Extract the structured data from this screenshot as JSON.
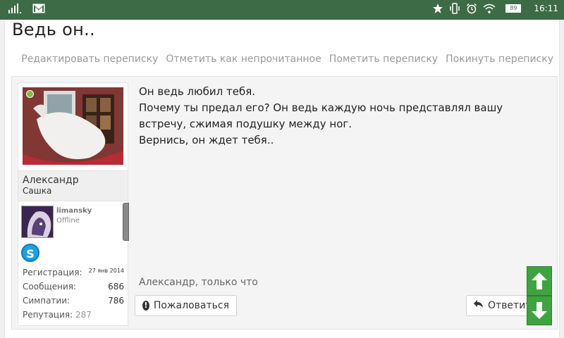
{
  "status_bar": {
    "time": "16:11",
    "battery": "89"
  },
  "thread": {
    "title": "Ведь он.."
  },
  "actions": {
    "edit": "Редактировать переписку",
    "mark_unread": "Отметить как непрочитанное",
    "label": "Пометить переписку",
    "leave": "Покинуть переписку"
  },
  "message": {
    "author": {
      "name": "Александр",
      "title": "Сашка",
      "extra_username": "limansky",
      "extra_status": "Offline",
      "stats": [
        {
          "label": "Регистрация:",
          "value": "27 янв 2014"
        },
        {
          "label": "Сообщения:",
          "value": "686"
        },
        {
          "label": "Симпатии:",
          "value": "786"
        },
        {
          "label": "Репутация:",
          "value": "287"
        }
      ]
    },
    "lines": [
      "Он ведь любил тебя.",
      "Почему ты предал его? Он ведь каждую ночь представлял вашу встречу, сжимая подушку между ног.",
      "Вернись, он ждет тебя.."
    ],
    "meta": "Александр, только что",
    "report_label": "Пожаловаться",
    "reply_label": "Ответить"
  },
  "colors": {
    "status_bar": "#3d6b46",
    "scroll_button": "#3fa340",
    "online": "#7ec13b",
    "skype": "#1ea1e0"
  }
}
